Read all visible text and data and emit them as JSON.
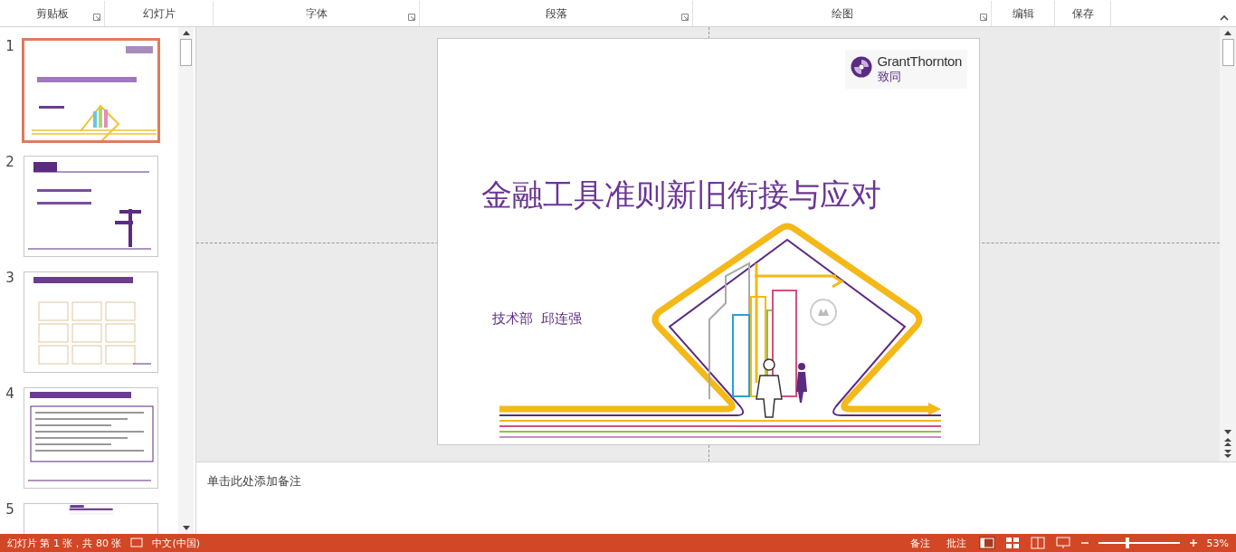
{
  "ribbon": {
    "groups": [
      {
        "label": "剪贴板",
        "launcher": true
      },
      {
        "label": "幻灯片",
        "launcher": false
      },
      {
        "label": "字体",
        "launcher": true
      },
      {
        "label": "段落",
        "launcher": true
      },
      {
        "label": "绘图",
        "launcher": true
      },
      {
        "label": "编辑",
        "launcher": false
      },
      {
        "label": "保存",
        "launcher": false
      }
    ]
  },
  "thumbnails": [
    {
      "number": "1",
      "kind": "title",
      "selected": true
    },
    {
      "number": "2",
      "kind": "agenda",
      "selected": false
    },
    {
      "number": "3",
      "kind": "grid",
      "selected": false
    },
    {
      "number": "4",
      "kind": "text",
      "selected": false
    },
    {
      "number": "5",
      "kind": "table",
      "selected": false
    }
  ],
  "slide": {
    "title": "金融工具准则新旧衔接与应对",
    "subtitle": "技术部  邱连强",
    "logo": {
      "name": "GrantThornton",
      "chinese": "致同"
    }
  },
  "notes": {
    "placeholder": "单击此处添加备注"
  },
  "status_bar": {
    "slide_info": "幻灯片 第 1 张，共 80 张",
    "language": "中文(中国)",
    "notes": "备注",
    "comments": "批注",
    "zoom_slider": {
      "level": 0.35
    },
    "zoom": "53%"
  }
}
